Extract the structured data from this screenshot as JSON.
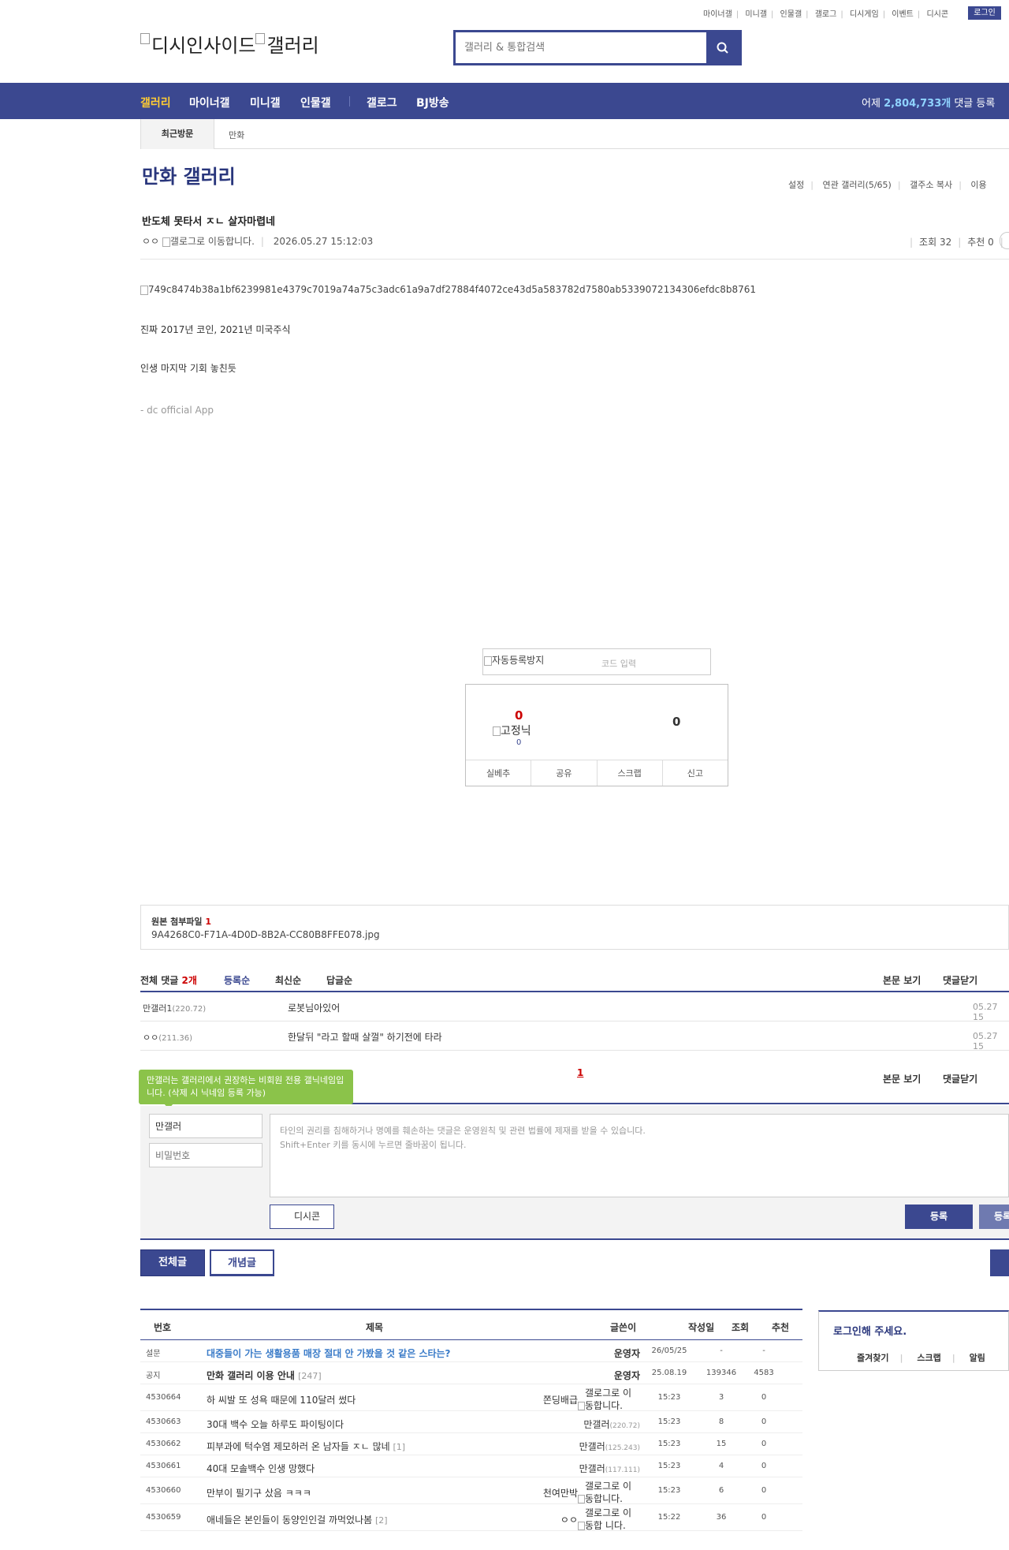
{
  "top_links": [
    "마이너갤",
    "미니갤",
    "인물갤",
    "갤로그",
    "디시게임",
    "이벤트",
    "디시콘"
  ],
  "login_label": "로그인",
  "logo": {
    "part1": "디시인사이드",
    "part2": "갤러리"
  },
  "search": {
    "placeholder": "갤러리 & 통합검색"
  },
  "nav": {
    "items": [
      "갤러리",
      "마이너갤",
      "미니갤",
      "인물갤",
      "갤로그",
      "BJ방송"
    ],
    "right_prefix": "어제 ",
    "right_count": "2,804,733개",
    "right_suffix": " 댓글 등록"
  },
  "recent": {
    "label": "최근방문",
    "item": "만화"
  },
  "gallery": {
    "title": "만화 갤러리",
    "links": [
      "설정",
      "연관 갤러리(5/65)",
      "갤주소 복사",
      "이용"
    ]
  },
  "post": {
    "title": "반도체 못타서 ㅈㄴ 살자마렵네",
    "author": "ㅇㅇ",
    "author_glg": "갤로그로 이동합니다.",
    "date": "2026.05.27 15:12:03",
    "views": "조회 32",
    "recommend": "추천 0",
    "image_alt": "749c8474b38a1bf6239981e4379c7019a74a75c3adc61a9a7df27884f4072ce43d5a583782d7580ab5339072134306efdc8b8761",
    "lines": [
      "진짜 2017년 코인, 2021년 미국주식",
      "인생 마지막 기회 놓친듯"
    ],
    "signature": "- dc official App"
  },
  "captcha": {
    "img_alt": "자동등록방지",
    "placeholder": "코드 입력"
  },
  "recommend_box": {
    "up": "0",
    "fixed_nick": "고정닉",
    "fixed_count": "0",
    "down": "0",
    "actions": [
      "실베추",
      "공유",
      "스크랩",
      "신고"
    ]
  },
  "attachment": {
    "title": "원본 첨부파일 ",
    "count": "1",
    "filename": "9A4268C0-F71A-4D0D-8B2A-CC80B8FFE078.jpg"
  },
  "comments": {
    "total_label": "전체 댓글 ",
    "total_count": "2개",
    "sorts": [
      "등록순",
      "최신순",
      "답글순"
    ],
    "view_body": "본문 보기",
    "close_comments": "댓글닫기",
    "items": [
      {
        "nick": "만갤러1",
        "ip": "(220.72)",
        "text": "로봇님아있어",
        "date": "05.27 15"
      },
      {
        "nick": "ㅇㅇ",
        "ip": "(211.36)",
        "text": "한달뒤 \"라고 할때 살껄\" 하기전에 타라",
        "date": "05.27 15"
      }
    ],
    "page": "1"
  },
  "tooltip": "만갤러는 갤러리에서 권장하는 비회원 전용 갤닉네임입니다. (삭제 시 닉네임 등록 가능)",
  "comment_write": {
    "nickname_value": "만갤러",
    "password_placeholder": "비밀번호",
    "textarea_line1": "타인의 권리를 침해하거나 명예를 훼손하는 댓글은 운영원칙 및 관련 법률에 제재를 받을 수 있습니다.",
    "textarea_line2": "Shift+Enter 키를 동시에 누르면 줄바꿈이 됩니다.",
    "dccon": "디시콘",
    "submit": "등록",
    "submit_reg": "등록"
  },
  "tabs": {
    "all": "전체글",
    "concept": "개념글"
  },
  "list": {
    "headers": {
      "num": "번호",
      "title": "제목",
      "writer": "글쓴이",
      "date": "작성일",
      "views": "조회",
      "rec": "추천"
    },
    "rows": [
      {
        "num": "설문",
        "title": "대중들이 가는 생활용품 매장 절대 안 가봤을 것 같은 스타는?",
        "reply": "",
        "writer": "운영자",
        "ip": "",
        "glg": "",
        "date": "26/05/25",
        "views": "-",
        "rec": "-",
        "kind": "survey"
      },
      {
        "num": "공지",
        "title": "만화 갤러리 이용 안내",
        "reply": "[247]",
        "writer": "운영자",
        "ip": "",
        "glg": "",
        "date": "25.08.19",
        "views": "139346",
        "rec": "4583",
        "kind": "notice"
      },
      {
        "num": "4530664",
        "title": "하 씨발 또 성욕 때문에 110달러 썼다",
        "reply": "",
        "writer": "쫀딩배급",
        "ip": "",
        "glg": "갤로그로 이 동합니다.",
        "date": "15:23",
        "views": "3",
        "rec": "0",
        "kind": "tall"
      },
      {
        "num": "4530663",
        "title": "30대 백수 오늘 하루도 파이팅이다",
        "reply": "",
        "writer": "만갤러",
        "ip": "(220.72)",
        "glg": "",
        "date": "15:23",
        "views": "8",
        "rec": "0",
        "kind": "normal"
      },
      {
        "num": "4530662",
        "title": "피부과에 턱수염 제모하러 온 남자들 ㅈㄴ 많네",
        "reply": "[1]",
        "writer": "만갤러",
        "ip": "(125.243)",
        "glg": "",
        "date": "15:23",
        "views": "15",
        "rec": "0",
        "kind": "normal"
      },
      {
        "num": "4530661",
        "title": "40대 모솔백수 인생 망했다",
        "reply": "",
        "writer": "만갤러",
        "ip": "(117.111)",
        "glg": "",
        "date": "15:23",
        "views": "4",
        "rec": "0",
        "kind": "normal"
      },
      {
        "num": "4530660",
        "title": "만부이 필기구 샀음 ㅋㅋㅋ",
        "reply": "",
        "writer": "천여만박",
        "ip": "",
        "glg": "갤로그로 이 동합니다.",
        "date": "15:23",
        "views": "6",
        "rec": "0",
        "kind": "tall"
      },
      {
        "num": "4530659",
        "title": "애네들은 본인들이 동양인인걸 까먹었나봄",
        "reply": "[2]",
        "writer": "ㅇㅇ",
        "ip": "",
        "glg": "갤로그로 이동합 니다.",
        "date": "15:22",
        "views": "36",
        "rec": "0",
        "kind": "tall"
      }
    ]
  },
  "login_box": {
    "message": "로그인해 주세요.",
    "links": [
      "즐겨찾기",
      "스크랩",
      "알림"
    ]
  },
  "colors": {
    "brand": "#3b4890",
    "nav_active": "#ffcc33",
    "alert": "#cc0000",
    "tooltip": "#8bc34a"
  }
}
